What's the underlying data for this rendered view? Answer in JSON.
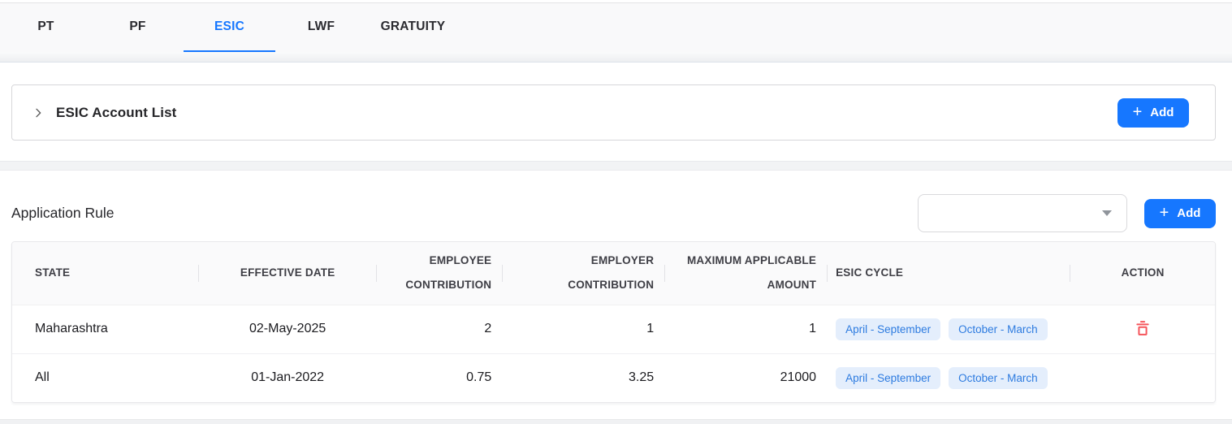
{
  "tabs": {
    "active_tab": "ESIC",
    "items": [
      {
        "label": "PT"
      },
      {
        "label": "PF"
      },
      {
        "label": "ESIC"
      },
      {
        "label": "LWF"
      },
      {
        "label": "GRATUITY"
      }
    ]
  },
  "account_section": {
    "title": "ESIC Account List",
    "add_button_label": "Add",
    "add_button_plus": "+"
  },
  "application_rule": {
    "title": "Application Rule",
    "dropdown_value": "",
    "add_button_label": "Add",
    "add_button_plus": "+"
  },
  "table": {
    "columns": [
      "STATE",
      "EFFECTIVE DATE",
      "EMPLOYEE CONTRIBUTION",
      "EMPLOYER CONTRIBUTION",
      "MAXIMUM APPLICABLE AMOUNT",
      "ESIC CYCLE",
      "ACTION"
    ],
    "rows": [
      {
        "state": "Maharashtra",
        "effective_date": "02-May-2025",
        "employee_contribution": "2",
        "employer_contribution": "1",
        "maximum_applicable_amount": "1",
        "esic_cycle": [
          "April - September",
          "October - March"
        ],
        "has_delete": true
      },
      {
        "state": "All",
        "effective_date": "01-Jan-2022",
        "employee_contribution": "0.75",
        "employer_contribution": "3.25",
        "maximum_applicable_amount": "21000",
        "esic_cycle": [
          "April - September",
          "October - March"
        ],
        "has_delete": false
      }
    ]
  },
  "colors": {
    "accent_blue": "#1677ff",
    "pill_background": "#e4eefc",
    "pill_text": "#2d7be0",
    "delete_red": "#f5565c",
    "tabbar_background": "#f9f9fa",
    "table_header_background": "#fafafb"
  }
}
